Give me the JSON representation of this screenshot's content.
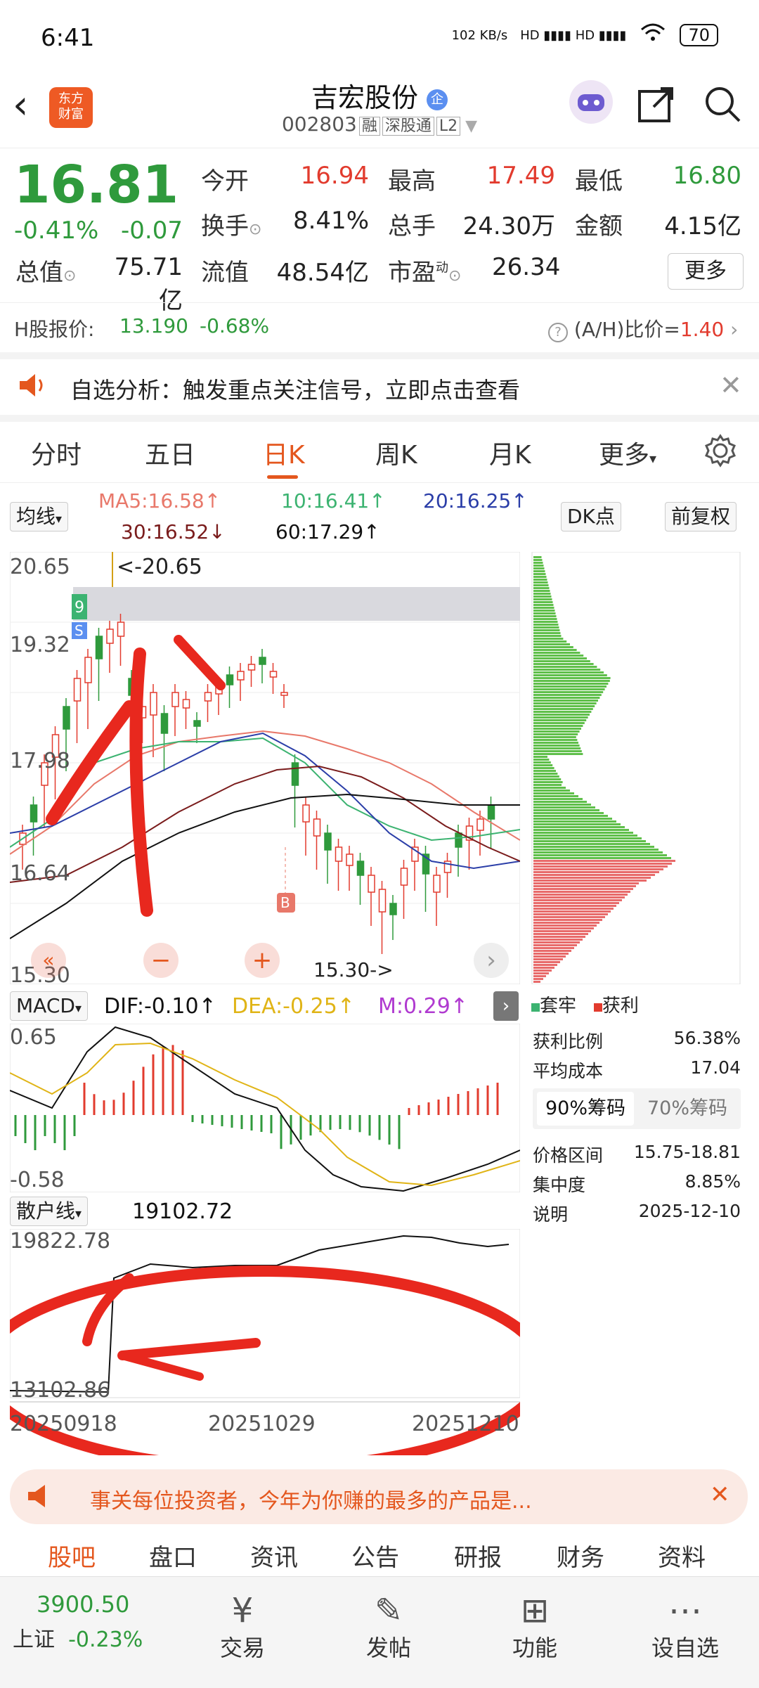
{
  "status_bar": {
    "time": "6:41",
    "net_speed": "102 KB/s",
    "signal": "HD ▮▮▮▮ HD ▮▮▮▮",
    "wifi": "wifi",
    "battery": "70"
  },
  "header": {
    "logo": "东方\n财富",
    "name": "吉宏股份",
    "code": "002803",
    "tags": [
      "融",
      "深股通",
      "L2"
    ]
  },
  "quote": {
    "price": "16.81",
    "change_pct": "-0.41%",
    "change": "-0.07",
    "open_label": "今开",
    "open": "16.94",
    "high_label": "最高",
    "high": "17.49",
    "low_label": "最低",
    "low": "16.80",
    "turnover_label": "换手",
    "turnover": "8.41%",
    "volume_label": "总手",
    "volume": "24.30万",
    "amount_label": "金额",
    "amount": "4.15亿",
    "mcap_label": "总值",
    "mcap": "75.71亿",
    "float_label": "流值",
    "float": "48.54亿",
    "pe_label": "市盈",
    "pe_sup": "动",
    "pe": "26.34",
    "more": "更多"
  },
  "hshare": {
    "label": "H股报价:",
    "price": "13.190",
    "pct": "-0.68%",
    "ratio_label": "(A/H)比价=",
    "ratio": "1.40"
  },
  "alert": {
    "text": "自选分析：触发重点关注信号，立即点击查看"
  },
  "tabs": [
    "分时",
    "五日",
    "日K",
    "周K",
    "月K",
    "更多"
  ],
  "ma": {
    "selector": "均线",
    "ma5": "MA5:16.58↑",
    "ma10": "10:16.41↑",
    "ma20": "20:16.25↑",
    "ma30": "30:16.52↓",
    "ma60": "60:17.29↑",
    "dk": "DK点",
    "fq": "前复权"
  },
  "kchart": {
    "y_top": "20.65",
    "y2": "19.32",
    "y3": "17.98",
    "y4": "16.64",
    "y_bottom": "15.30",
    "high_marker": "<-20.65",
    "low_marker": "15.30->"
  },
  "macd": {
    "selector": "MACD",
    "dif": "DIF:-0.10↑",
    "dea": "DEA:-0.25↑",
    "m": "M:0.29↑",
    "y_top": "0.65",
    "y_bottom": "-0.58"
  },
  "sanhu": {
    "selector": "散户线",
    "value": "19102.72",
    "y_top": "19822.78",
    "y_bottom": "13102.86",
    "dates": [
      "20250918",
      "20251029",
      "20251210"
    ]
  },
  "chips": {
    "legend_trap": "套牢",
    "legend_profit": "获利",
    "profit_ratio_label": "获利比例",
    "profit_ratio": "56.38%",
    "avg_cost_label": "平均成本",
    "avg_cost": "17.04",
    "tab90": "90%筹码",
    "tab70": "70%筹码",
    "range_label": "价格区间",
    "range": "15.75-18.81",
    "conc_label": "集中度",
    "conc": "8.85%",
    "date_label": "说明",
    "date": "2025-12-10"
  },
  "ad": {
    "text": "事关每位投资者，今年为你赚的最多的产品是..."
  },
  "subtabs": [
    "股吧",
    "盘口",
    "资讯",
    "公告",
    "研报",
    "财务",
    "资料"
  ],
  "bottom": {
    "index_value": "3900.50",
    "index_name": "上证",
    "index_pct": "-0.23%",
    "items": [
      "交易",
      "发帖",
      "功能",
      "设自选"
    ]
  },
  "colors": {
    "up": "#e23b2e",
    "down": "#2f9a3c",
    "accent": "#e4571e"
  }
}
